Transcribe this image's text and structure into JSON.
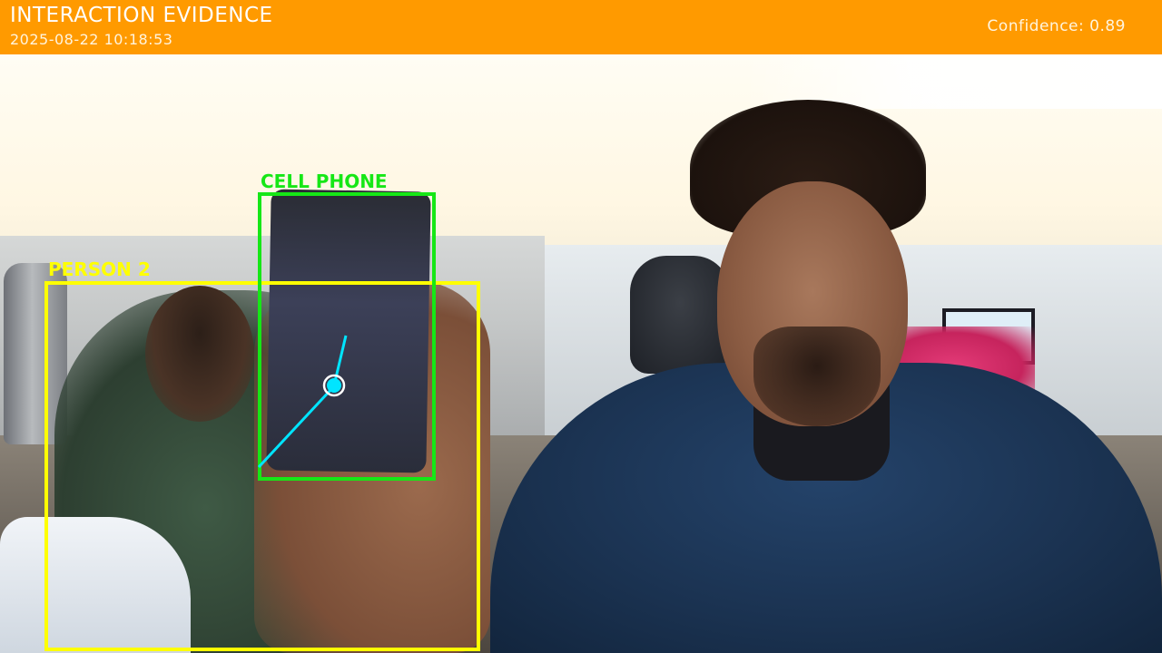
{
  "header": {
    "title": "INTERACTION EVIDENCE",
    "timestamp": "2025-08-22 10:18:53",
    "confidence": "Confidence: 0.89",
    "bar_color": "#ff9a00"
  },
  "detections": [
    {
      "label": "PERSON 2",
      "color": "#ffff00"
    },
    {
      "label": "CELL PHONE",
      "color": "#16e716"
    }
  ],
  "interaction_marker": {
    "color": "#00e5ff",
    "icon": "contact-point-icon"
  }
}
